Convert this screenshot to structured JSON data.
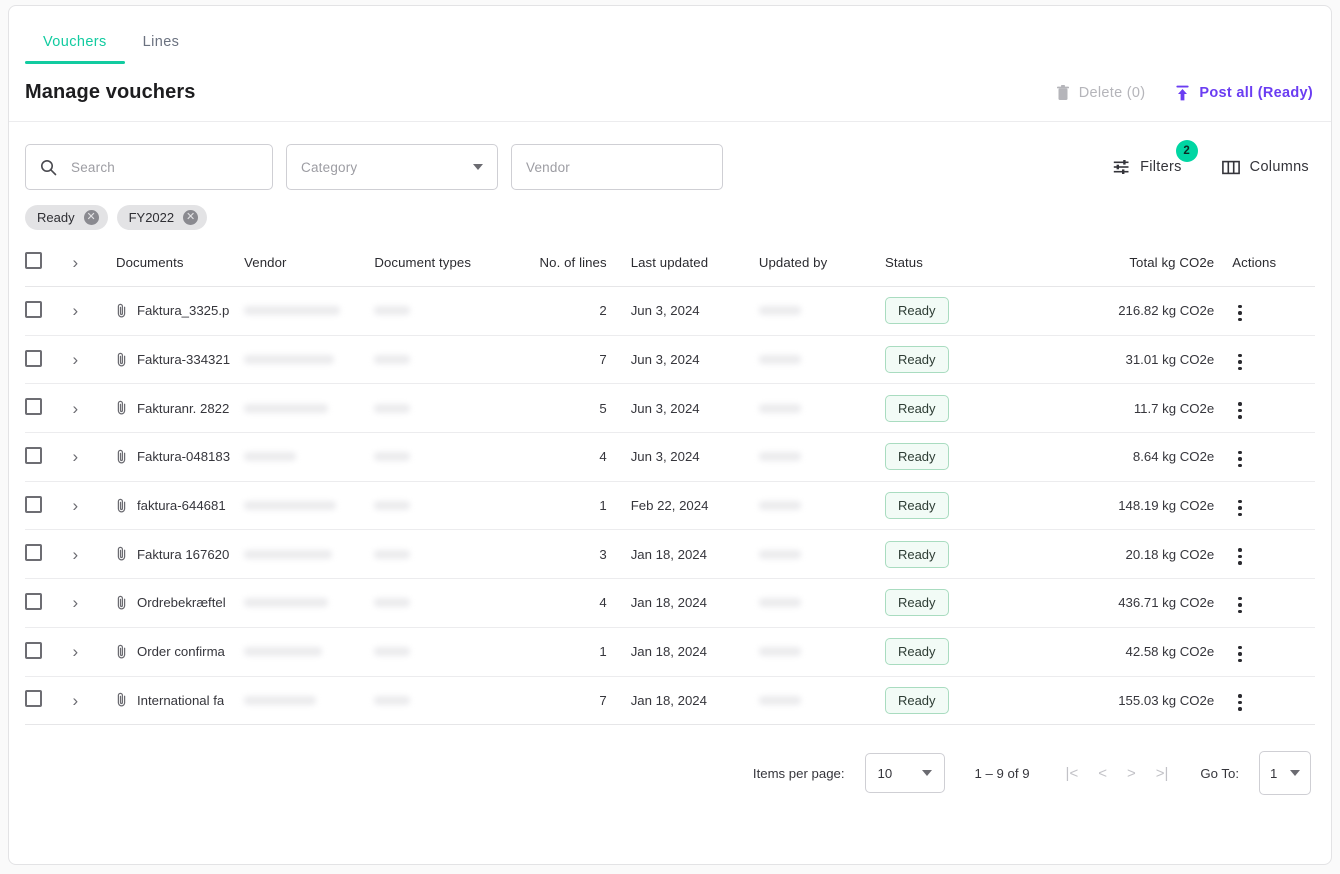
{
  "tabs": [
    {
      "label": "Vouchers",
      "active": true
    },
    {
      "label": "Lines",
      "active": false
    }
  ],
  "header": {
    "title": "Manage vouchers",
    "delete_label": "Delete (0)",
    "post_all_label": "Post all (Ready)",
    "accent_teal": "#12cba0",
    "accent_purple": "#6b3df2"
  },
  "filters": {
    "search_placeholder": "Search",
    "category_placeholder": "Category",
    "vendor_placeholder": "Vendor",
    "filters_label": "Filters",
    "filters_badge": "2",
    "columns_label": "Columns",
    "chips": [
      {
        "label": "Ready",
        "remove": "✕"
      },
      {
        "label": "FY2022",
        "remove": "✕"
      }
    ]
  },
  "table": {
    "columns": [
      "Documents",
      "Vendor",
      "Document types",
      "No. of lines",
      "Last updated",
      "Updated by",
      "Status",
      "Total kg CO2e",
      "Actions"
    ],
    "rows": [
      {
        "document": "Faktura_3325.p",
        "vendor": "",
        "doc_type": "",
        "lines": "2",
        "last_updated": "Jun 3, 2024",
        "updated_by": "",
        "status": "Ready",
        "co2": "216.82 kg CO2e",
        "redact_vendor_w": 96,
        "redact_type_w": 36
      },
      {
        "document": "Faktura-334321",
        "vendor": "",
        "doc_type": "",
        "lines": "7",
        "last_updated": "Jun 3, 2024",
        "updated_by": "",
        "status": "Ready",
        "co2": "31.01 kg CO2e",
        "redact_vendor_w": 90,
        "redact_type_w": 36
      },
      {
        "document": "Fakturanr. 2822",
        "vendor": "",
        "doc_type": "",
        "lines": "5",
        "last_updated": "Jun 3, 2024",
        "updated_by": "",
        "status": "Ready",
        "co2": "11.7 kg CO2e",
        "redact_vendor_w": 84,
        "redact_type_w": 36
      },
      {
        "document": "Faktura-048183",
        "vendor": "",
        "doc_type": "",
        "lines": "4",
        "last_updated": "Jun 3, 2024",
        "updated_by": "",
        "status": "Ready",
        "co2": "8.64 kg CO2e",
        "redact_vendor_w": 52,
        "redact_type_w": 36
      },
      {
        "document": "faktura-644681",
        "vendor": "",
        "doc_type": "",
        "lines": "1",
        "last_updated": "Feb 22, 2024",
        "updated_by": "",
        "status": "Ready",
        "co2": "148.19 kg CO2e",
        "redact_vendor_w": 92,
        "redact_type_w": 36
      },
      {
        "document": "Faktura 167620",
        "vendor": "",
        "doc_type": "",
        "lines": "3",
        "last_updated": "Jan 18, 2024",
        "updated_by": "",
        "status": "Ready",
        "co2": "20.18 kg CO2e",
        "redact_vendor_w": 88,
        "redact_type_w": 36
      },
      {
        "document": "Ordrebekræftel",
        "vendor": "",
        "doc_type": "",
        "lines": "4",
        "last_updated": "Jan 18, 2024",
        "updated_by": "",
        "status": "Ready",
        "co2": "436.71 kg CO2e",
        "redact_vendor_w": 84,
        "redact_type_w": 36
      },
      {
        "document": "Order confirma",
        "vendor": "",
        "doc_type": "",
        "lines": "1",
        "last_updated": "Jan 18, 2024",
        "updated_by": "",
        "status": "Ready",
        "co2": "42.58 kg CO2e",
        "redact_vendor_w": 78,
        "redact_type_w": 36
      },
      {
        "document": "International fa",
        "vendor": "",
        "doc_type": "",
        "lines": "7",
        "last_updated": "Jan 18, 2024",
        "updated_by": "",
        "status": "Ready",
        "co2": "155.03 kg CO2e",
        "redact_vendor_w": 72,
        "redact_type_w": 36
      }
    ],
    "status_badge_bg": "#f2fbf6",
    "status_badge_border": "#a9dcc0"
  },
  "pagination": {
    "items_per_page_label": "Items per page:",
    "items_per_page_value": "10",
    "range_label": "1 – 9 of 9",
    "first_icon": "|<",
    "prev_icon": "<",
    "next_icon": ">",
    "last_icon": ">|",
    "goto_label": "Go To:",
    "goto_value": "1"
  }
}
